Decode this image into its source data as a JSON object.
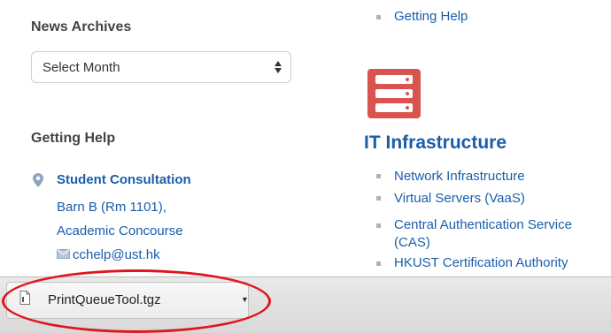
{
  "sidebar": {
    "news_archives_heading": "News Archives",
    "month_select": {
      "selected": "Select Month",
      "icon": "sort-arrows-icon"
    },
    "getting_help_heading": "Getting Help",
    "contact": {
      "location_icon": "map-pin-icon",
      "title": "Student Consultation",
      "address_line1": "Barn B (Rm 1101),",
      "address_line2": "Academic Concourse",
      "email_icon": "envelope-icon",
      "email": "cchelp@ust.hk"
    }
  },
  "main": {
    "top_link": "Getting Help",
    "section_icon": "server-rack-icon",
    "section_title": "IT Infrastructure",
    "links": [
      "Network Infrastructure",
      "Virtual Servers (VaaS)",
      "Central Authentication Service (CAS)",
      "HKUST Certification Authority"
    ]
  },
  "download_bar": {
    "file_name": "PrintQueueTool.tgz",
    "file_icon": "document-icon",
    "menu_icon": "caret-down-icon"
  },
  "colors": {
    "link": "#1a5daa",
    "heading": "#444444",
    "accent_icon": "#d9534f",
    "highlight_oval": "#e0161d",
    "bullet": "#a8b4c2"
  }
}
